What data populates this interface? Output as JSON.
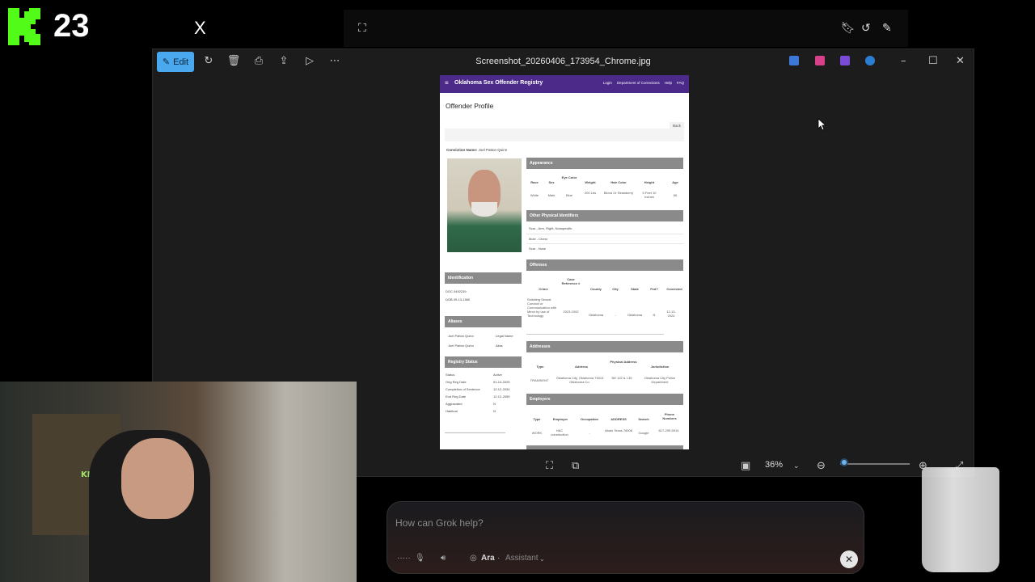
{
  "overlay": {
    "kick_number": "23",
    "x_logo": "X"
  },
  "viewer": {
    "edit_label": "Edit",
    "file_title": "Screenshot_20260406_173954_Chrome.jpg",
    "zoom": "36%"
  },
  "doc": {
    "brand": "Oklahoma Sex Offender Registry",
    "nav": [
      "Login",
      "Department of Corrections",
      "Help",
      "FAQ"
    ],
    "title": "Offender Profile",
    "back": "Back",
    "conviction_label": "Conviction Name:",
    "conviction_name": "Joel Patton Quinn",
    "sections": {
      "appearance": "Appearance",
      "physical": "Other Physical Identifiers",
      "offenses": "Offenses",
      "addresses": "Addresses",
      "employers": "Employers",
      "identification": "Identification",
      "aliases": "Aliases",
      "registry": "Registry Status"
    },
    "appearance": {
      "headers": [
        "Race",
        "Sex",
        "Eye Color",
        "Weight",
        "Hair Color",
        "Height",
        "Age"
      ],
      "values": [
        "White",
        "Male",
        "Blue",
        "200 Lbs",
        "Blond Or Strawberry",
        "5 Feet 10 Inches",
        "65"
      ]
    },
    "physical": [
      "Scar - Arm, Right, Nonspecific",
      "Mole - Chest",
      "Scar - Nose"
    ],
    "offenses": {
      "headers": [
        "Crime",
        "Case Reference #",
        "County",
        "City",
        "State",
        "Fed?",
        "Convicted"
      ],
      "values": [
        "Soliciting Sexual Conduct or Communication with Minor by use of Technology",
        "2023-1092",
        "Oklahoma",
        "-",
        "Oklahoma",
        "N",
        "12-13-2024"
      ]
    },
    "addresses": {
      "headers": [
        "Type",
        "Address",
        "Physical Address",
        "Jurisdiction"
      ],
      "values": [
        "TRANSIENT",
        "Oklahoma City, Oklahoma 73013 Oklahoma Co.",
        "NE 122 & I-35",
        "Oklahoma City Police Department"
      ]
    },
    "employers": {
      "headers": [
        "Type",
        "Employer",
        "Occupation",
        "ADDRESS",
        "Search",
        "Phone Numbers"
      ],
      "values": [
        "WORK",
        "H&C construction",
        "-",
        "Abalo Texas 76008",
        "Google",
        "817-299-5914"
      ]
    },
    "identification": [
      "DOC 0492239",
      "DOB 09-13-1960"
    ],
    "aliases": [
      {
        "name": "Joel Patton Quinn",
        "type": "Legal Name"
      },
      {
        "name": "Joel Patton Quinn",
        "type": "Alias"
      }
    ],
    "registry": [
      {
        "k": "Status",
        "v": "Active"
      },
      {
        "k": "Orig Reg Date",
        "v": "01-14-2025"
      },
      {
        "k": "Completion of Sentence",
        "v": "12-12-2034"
      },
      {
        "k": "End Reg Date",
        "v": "12-12-2059"
      },
      {
        "k": "Aggravated",
        "v": "N"
      },
      {
        "k": "Habitual",
        "v": "N"
      }
    ]
  },
  "grok": {
    "placeholder": "How can Grok help?",
    "voice_name": "Ara",
    "mode": "Assistant"
  }
}
